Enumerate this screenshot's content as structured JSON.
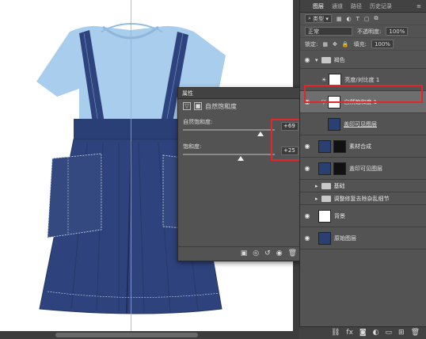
{
  "panel_tabs": {
    "layers": "图层",
    "channels": "通道",
    "paths": "路径",
    "history": "历史记录"
  },
  "filter": {
    "kind": "类型"
  },
  "blend": {
    "mode": "正常",
    "opacity_label": "不透明度:",
    "opacity": "100%",
    "lock_label": "锁定:",
    "fill_label": "填充:",
    "fill": "100%"
  },
  "layers": [
    {
      "name": "褐色",
      "type": "group",
      "visible": true
    },
    {
      "name": "亮度/对比度 1",
      "type": "adjustment",
      "visible": false
    },
    {
      "name": "自然饱和度 1",
      "type": "adjustment",
      "visible": true,
      "selected": true
    },
    {
      "name": "盖印可见图层",
      "type": "pixel",
      "visible": false
    },
    {
      "name": "素材合成",
      "type": "pixel",
      "visible": true
    },
    {
      "name": "盖印可见图层",
      "type": "pixel",
      "visible": true
    },
    {
      "name": "基础",
      "type": "group",
      "visible": false
    },
    {
      "name": "调整修复去除杂乱细节",
      "type": "group",
      "visible": false
    },
    {
      "name": "背景",
      "type": "pixel",
      "visible": true
    },
    {
      "name": "原始图层",
      "type": "pixel",
      "visible": true
    }
  ],
  "properties": {
    "title": "属性",
    "header": "自然饱和度",
    "vibrance_label": "自然饱和度:",
    "vibrance": "+69",
    "vibrance_fraction": 0.845,
    "saturation_label": "饱和度:",
    "saturation": "+25",
    "saturation_fraction": 0.625
  },
  "colors": {
    "highlight": "#e2262c",
    "shirt": "#a9cdec",
    "skirt": "#2e437d",
    "guide": "#43d6e6"
  }
}
